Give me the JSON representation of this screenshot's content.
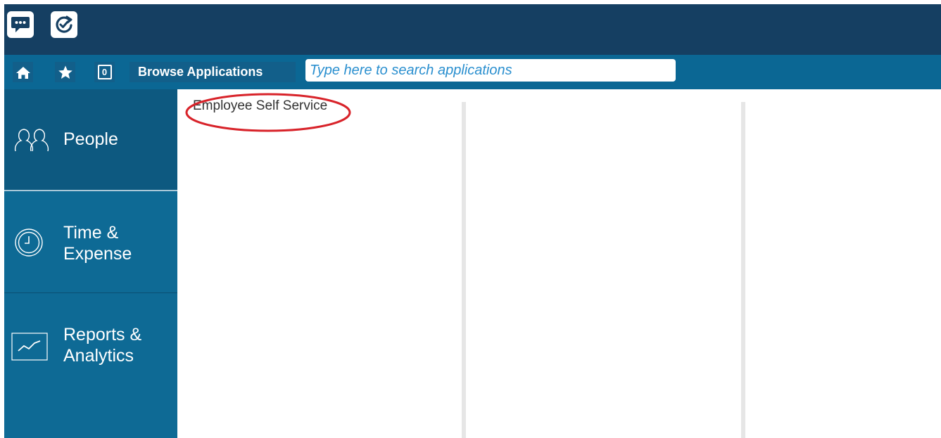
{
  "topbar": {
    "apps": [
      {
        "name": "chat-icon"
      },
      {
        "name": "refresh-check-icon"
      }
    ],
    "background": "#153f62"
  },
  "toolbar": {
    "home_icon": "home-icon",
    "favorites_icon": "star-icon",
    "counter_value": "0",
    "browse_label": "Browse Applications",
    "search_placeholder": "Type here to search applications",
    "background": "#0b6794"
  },
  "sidebar": {
    "items": [
      {
        "label": "People",
        "icon": "people-icon",
        "active": true
      },
      {
        "label_line1": "Time &",
        "label_line2": "Expense",
        "icon": "clock-icon",
        "active": false
      },
      {
        "label_line1": "Reports &",
        "label_line2": "Analytics",
        "icon": "chart-icon",
        "active": false
      }
    ],
    "background": "#0e6a95",
    "active_background": "#0d5980"
  },
  "content": {
    "columns": [
      {
        "apps": [
          "Employee Self Service"
        ]
      },
      {
        "apps": []
      },
      {
        "apps": []
      }
    ],
    "highlight_color": "#d8232a"
  }
}
